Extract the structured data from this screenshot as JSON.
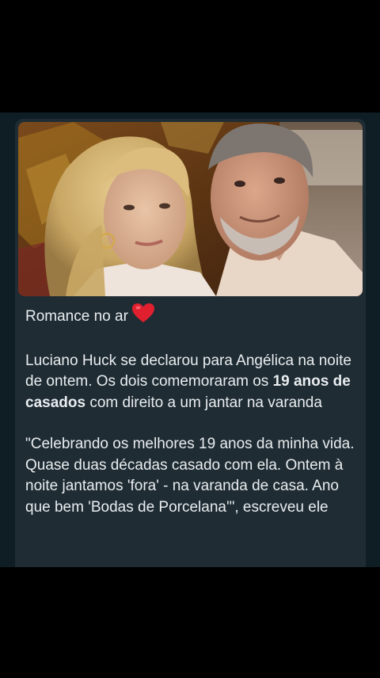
{
  "message": {
    "headline_text": "Romance no ar",
    "headline_emoji": "heart-emoji",
    "paragraph1": {
      "part1": "Luciano Huck se declarou para Angélica na noite de ontem. Os dois comemoraram os ",
      "bold": "19 anos de casados",
      "part2": " com direito a um jantar na varanda"
    },
    "paragraph2": "\"Celebrando os melhores 19 anos da minha vida. Quase duas décadas casado com ela. Ontem à noite jantamos 'fora' - na varanda de casa. Ano que bem 'Bodas de Porcelana'\", escreveu ele"
  },
  "colors": {
    "screen_bg": "#000000",
    "chat_bg": "#0f1d25",
    "bubble_bg": "#1f2c34",
    "text": "#e9edef",
    "heart": "#e0202f"
  }
}
